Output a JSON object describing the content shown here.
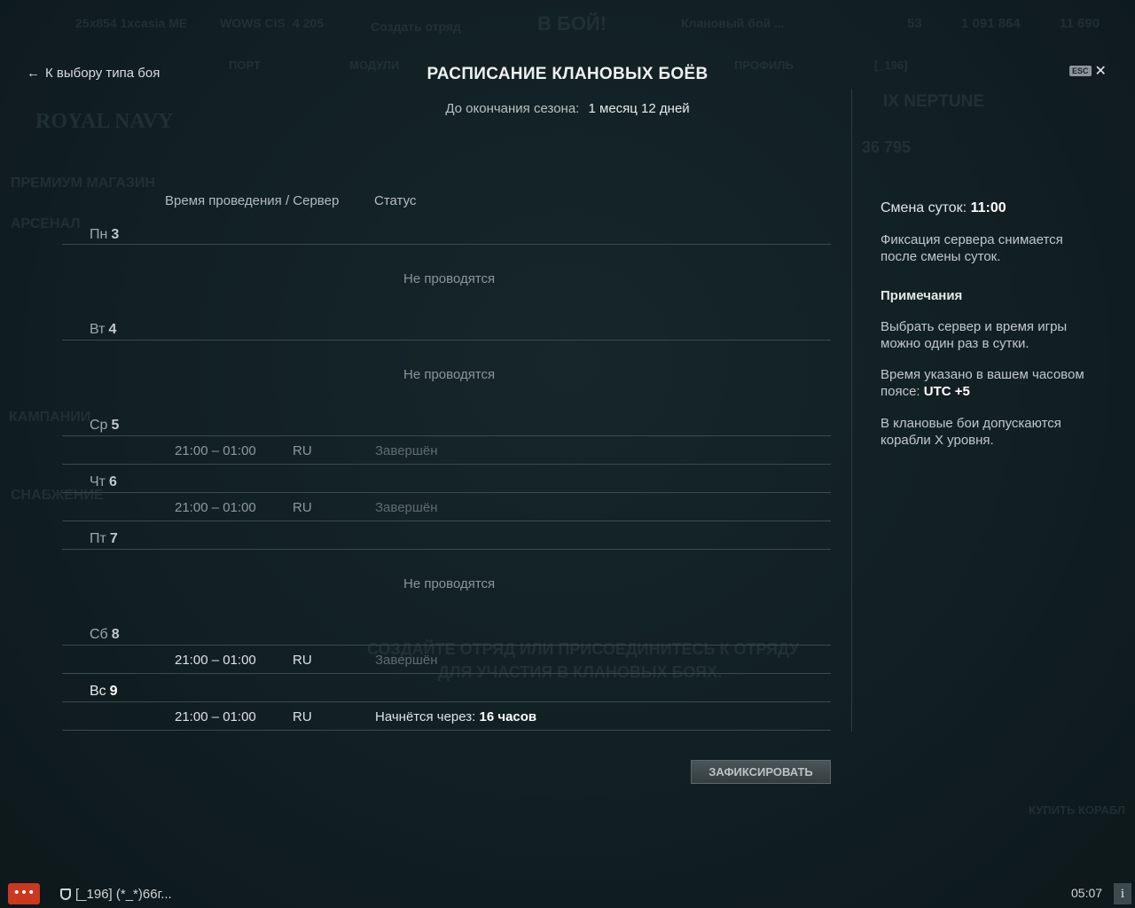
{
  "header": {
    "back_label": "К выбору типа боя",
    "title": "РАСПИСАНИЕ КЛАНОВЫХ БОЁВ",
    "season_label": "До окончания сезона:",
    "season_value": "1 месяц 12 дней",
    "esc_label": "ESC",
    "close_symbol": "✕"
  },
  "background": {
    "user": "25x854 1xcasia ME",
    "server": "WOWS CIS",
    "online": "4 205",
    "create_squad": "Создать отряд",
    "battle_btn": "В БОЙ!",
    "mode": "Клановый бой ...",
    "port": "ПОРТ",
    "modules": "МОДУЛИ",
    "profile": "ПРОФИЛЬ",
    "clan_tag": "[_196]",
    "nation": "ROYAL NAVY",
    "ship": "IX NEPTUNE",
    "premium_shop": "ПРЕМИУМ МАГАЗИН",
    "arsenal": "АРСЕНАЛ",
    "campaigns": "КАМПАНИИ",
    "supply": "СНАБЖЕНИЕ",
    "create_or_join": "СОЗДАЙТЕ ОТРЯД ИЛИ ПРИСОЕДИНИТЕСЬ К ОТРЯДУ",
    "for_clan_battles": "ДЛЯ УЧАСТИЯ В КЛАНОВЫХ БОЯХ.",
    "buy_ship": "КУПИТЬ КОРАБЛ",
    "doubloons": "53",
    "credits": "1 091 864",
    "free_xp": "11 690",
    "ship_xp": "36 795"
  },
  "schedule": {
    "col_time_server": "Время проведения / Сервер",
    "col_status": "Статус",
    "not_held": "Не проводятся",
    "days": [
      {
        "name": "Пн",
        "num": "3"
      },
      {
        "name": "Вт",
        "num": "4"
      },
      {
        "name": "Ср",
        "num": "5",
        "time": "21:00 – 01:00",
        "server": "RU",
        "status": "Завершён"
      },
      {
        "name": "Чт",
        "num": "6",
        "time": "21:00 – 01:00",
        "server": "RU",
        "status": "Завершён"
      },
      {
        "name": "Пт",
        "num": "7"
      },
      {
        "name": "Сб",
        "num": "8",
        "time": "21:00 – 01:00",
        "server": "RU",
        "status": "Завершён"
      },
      {
        "name": "Вс",
        "num": "9",
        "time": "21:00 – 01:00",
        "server": "RU",
        "status_prefix": "Начнётся через:",
        "status_value": "16 часов"
      }
    ],
    "fix_button": "ЗАФИКСИРОВАТЬ"
  },
  "info": {
    "reset_label": "Смена суток:",
    "reset_value": "11:00",
    "server_fix_note": "Фиксация сервера снимается после смены суток.",
    "notes_heading": "Примечания",
    "note1": "Выбрать сервер и время игры можно один раз в сутки.",
    "note2_prefix": "Время указано в вашем часовом поясе:",
    "note2_value": "UTC +5",
    "note3": "В клановые бои допускаются корабли X уровня."
  },
  "footer": {
    "chat_preview": "[_196] (*_*)66г...",
    "clock": "05:07",
    "info_symbol": "i",
    "chat_symbol": "•••"
  },
  "colors": {
    "background": "#17262a",
    "accent_chat": "#c9381f",
    "text_bright": "#ffffff"
  }
}
